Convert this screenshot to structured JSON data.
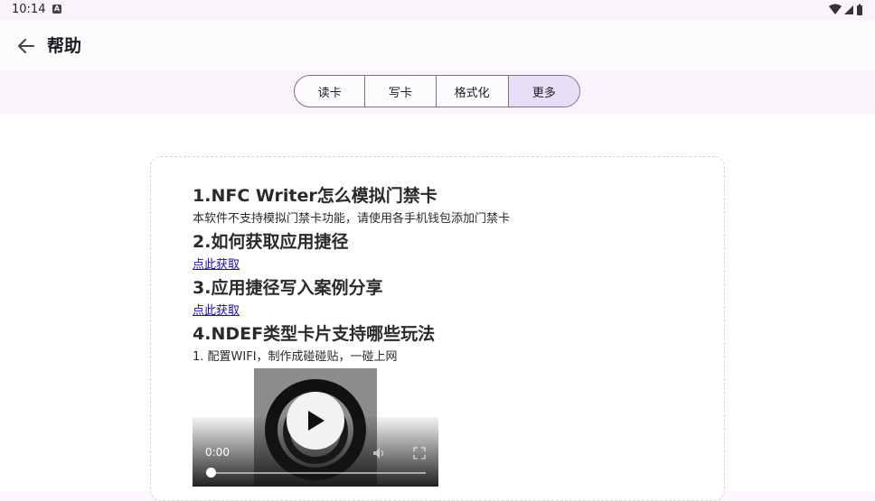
{
  "status_bar": {
    "time": "10:14",
    "badge": "A"
  },
  "app_bar": {
    "title": "帮助",
    "back_icon": "arrow-left-icon"
  },
  "tabs": [
    {
      "label": "读卡",
      "selected": false
    },
    {
      "label": "写卡",
      "selected": false
    },
    {
      "label": "格式化",
      "selected": false
    },
    {
      "label": "更多",
      "selected": true
    }
  ],
  "help": {
    "q1": {
      "title": "1.NFC Writer怎么模拟门禁卡",
      "body": "本软件不支持模拟门禁卡功能，请使用各手机钱包添加门禁卡"
    },
    "q2": {
      "title": "2.如何获取应用捷径",
      "link": "点此获取"
    },
    "q3": {
      "title": "3.应用捷径写入案例分享",
      "link": "点此获取"
    },
    "q4": {
      "title": "4.NDEF类型卡片支持哪些玩法",
      "body": "1. 配置WIFI，制作成碰碰贴，一碰上网"
    }
  },
  "video": {
    "time": "0:00",
    "progress": 0
  },
  "colors": {
    "selected_tab": "#e8def8",
    "link": "#1a0dab"
  }
}
